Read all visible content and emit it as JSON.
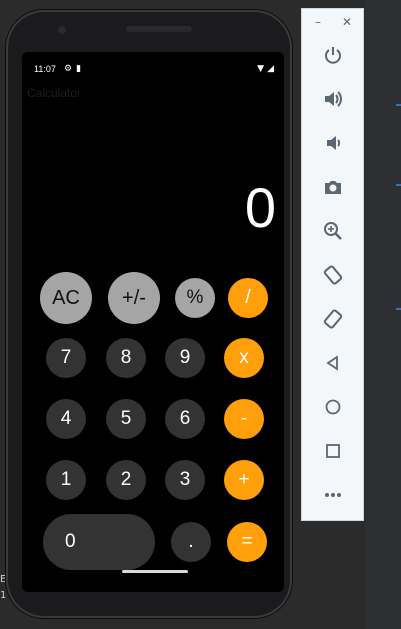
{
  "status_bar": {
    "time": "11:07"
  },
  "app": {
    "title": "Calculator",
    "display_value": "0"
  },
  "keypad": {
    "rows": [
      [
        {
          "label": "AC",
          "style": "light"
        },
        {
          "label": "+/-",
          "style": "light"
        },
        {
          "label": "%",
          "style": "light"
        },
        {
          "label": "/",
          "style": "orange"
        }
      ],
      [
        {
          "label": "7",
          "style": "dark"
        },
        {
          "label": "8",
          "style": "dark"
        },
        {
          "label": "9",
          "style": "dark"
        },
        {
          "label": "x",
          "style": "orange"
        }
      ],
      [
        {
          "label": "4",
          "style": "dark"
        },
        {
          "label": "5",
          "style": "dark"
        },
        {
          "label": "6",
          "style": "dark"
        },
        {
          "label": "-",
          "style": "orange"
        }
      ],
      [
        {
          "label": "1",
          "style": "dark"
        },
        {
          "label": "2",
          "style": "dark"
        },
        {
          "label": "3",
          "style": "dark"
        },
        {
          "label": "+",
          "style": "orange"
        }
      ],
      [
        {
          "label": "0",
          "style": "dark"
        },
        {
          "label": ".",
          "style": "dark"
        },
        {
          "label": "=",
          "style": "orange"
        }
      ]
    ]
  },
  "colors": {
    "orange": "#ff9f0a",
    "light": "#a5a5a5",
    "dark": "#333333",
    "screen": "#000000"
  },
  "emulator_panel": {
    "window_controls": [
      "minimize-icon",
      "close-icon"
    ],
    "tools": [
      "power-icon",
      "volume-up-icon",
      "volume-down-icon",
      "camera-icon",
      "zoom-icon",
      "rotate-left-icon",
      "rotate-right-icon",
      "back-icon",
      "home-icon",
      "overview-icon",
      "more-icon"
    ]
  }
}
